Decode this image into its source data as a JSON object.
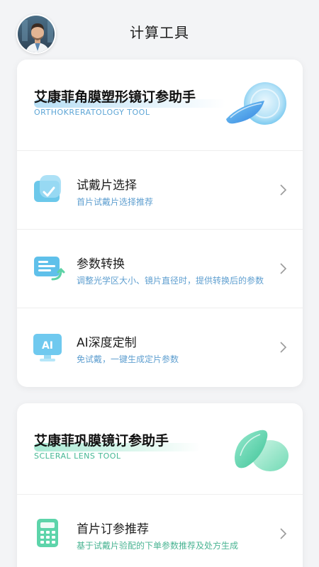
{
  "header": {
    "title": "计算工具",
    "avatar_icon": "doctor-avatar"
  },
  "ortho_card": {
    "title": "艾康菲角膜塑形镜订参助手",
    "subtitle": "ORTHOKRERATOLOGY TOOL",
    "hero_icon": "ortho-lens-icon",
    "accent": "#5ea6d6",
    "items": [
      {
        "label": "试戴片选择",
        "desc": "首片试戴片选择推荐",
        "icon": "trial-lens-icon"
      },
      {
        "label": "参数转换",
        "desc": "调整光学区大小、镜片直径时，提供转换后的参数",
        "icon": "convert-icon"
      },
      {
        "label": "AI深度定制",
        "desc": "免试戴，一键生成定片参数",
        "icon": "ai-monitor-icon"
      }
    ]
  },
  "scleral_card": {
    "title": "艾康菲巩膜镜订参助手",
    "subtitle": "SCLERAL LENS TOOL",
    "hero_icon": "scleral-lens-icon",
    "accent": "#46b894",
    "items": [
      {
        "label": "首片订参推荐",
        "desc": "基于试戴片验配的下单参数推荐及处方生成",
        "icon": "calculator-icon"
      }
    ]
  }
}
